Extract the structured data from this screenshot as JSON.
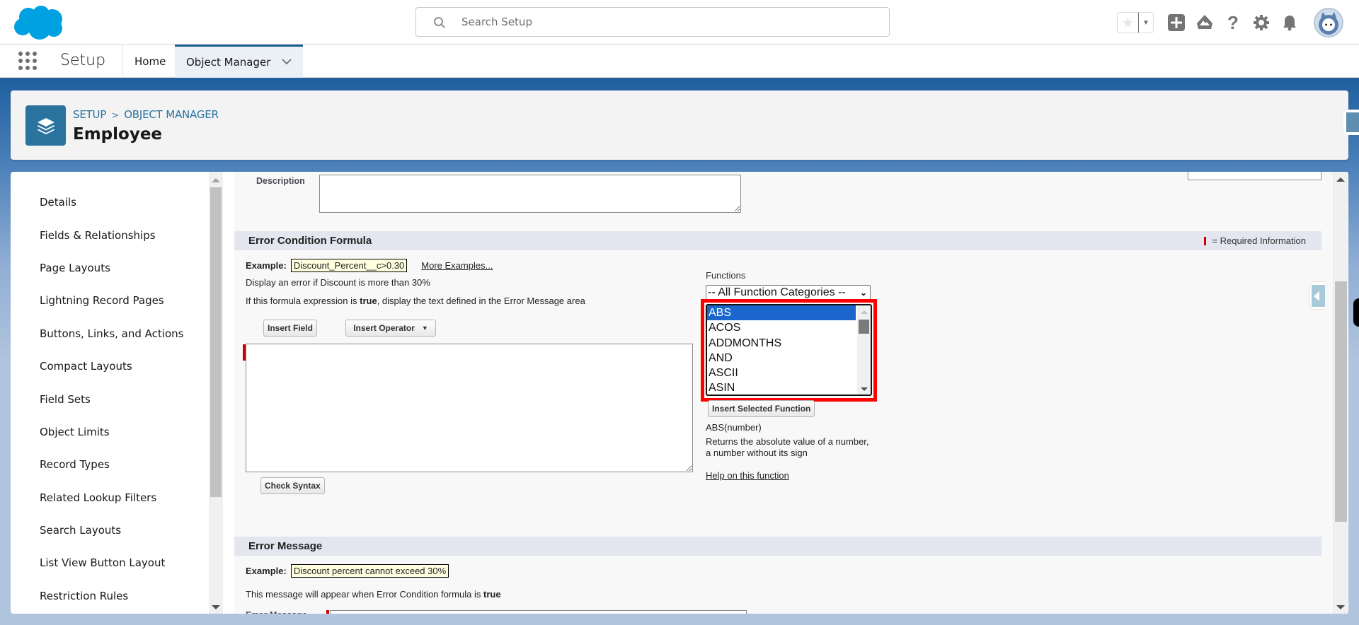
{
  "header": {
    "search_placeholder": "Search Setup",
    "icons": [
      "favorites-star-icon",
      "favorites-dropdown-icon",
      "global-actions-plus-icon",
      "trailhead-icon",
      "help-icon",
      "setup-gear-icon",
      "notifications-bell-icon",
      "user-avatar"
    ]
  },
  "nav": {
    "app_name": "Setup",
    "tabs": [
      {
        "label": "Home",
        "active": false
      },
      {
        "label": "Object Manager",
        "active": true
      }
    ]
  },
  "page_header": {
    "breadcrumb": [
      "SETUP",
      "OBJECT MANAGER"
    ],
    "breadcrumb_sep": ">",
    "title": "Employee"
  },
  "sidebar": {
    "items": [
      {
        "label": "Details"
      },
      {
        "label": "Fields & Relationships"
      },
      {
        "label": "Page Layouts"
      },
      {
        "label": "Lightning Record Pages"
      },
      {
        "label": "Buttons, Links, and Actions"
      },
      {
        "label": "Compact Layouts"
      },
      {
        "label": "Field Sets"
      },
      {
        "label": "Object Limits"
      },
      {
        "label": "Record Types"
      },
      {
        "label": "Related Lookup Filters"
      },
      {
        "label": "Search Layouts"
      },
      {
        "label": "List View Button Layout"
      },
      {
        "label": "Restriction Rules"
      }
    ]
  },
  "content": {
    "description_label": "Description",
    "description_value": "",
    "error_condition": {
      "title": "Error Condition Formula",
      "required_info": "= Required Information",
      "example_label": "Example:",
      "example_value": "Discount_Percent__c>0.30",
      "more_examples": "More Examples...",
      "example_desc": "Display an error if Discount is more than 30%",
      "hint_prefix": "If this formula expression is ",
      "hint_bold": "true",
      "hint_suffix": ", display the text defined in the Error Message area",
      "insert_field": "Insert Field",
      "insert_operator": "Insert Operator",
      "formula_value": "",
      "check_syntax": "Check Syntax"
    },
    "functions": {
      "label": "Functions",
      "category_selected": "-- All Function Categories --",
      "options": [
        "ABS",
        "ACOS",
        "ADDMONTHS",
        "AND",
        "ASCII",
        "ASIN"
      ],
      "selected": "ABS",
      "insert_button": "Insert Selected Function",
      "signature": "ABS(number)",
      "description": "Returns the absolute value of a number, a number without its sign",
      "help_link": "Help on this function"
    },
    "error_message": {
      "title": "Error Message",
      "example_label": "Example:",
      "example_value": "Discount percent cannot exceed 30%",
      "hint_prefix": "This message will appear when Error Condition formula is ",
      "hint_bold": "true",
      "field_label": "Error Message",
      "field_value": ""
    }
  }
}
